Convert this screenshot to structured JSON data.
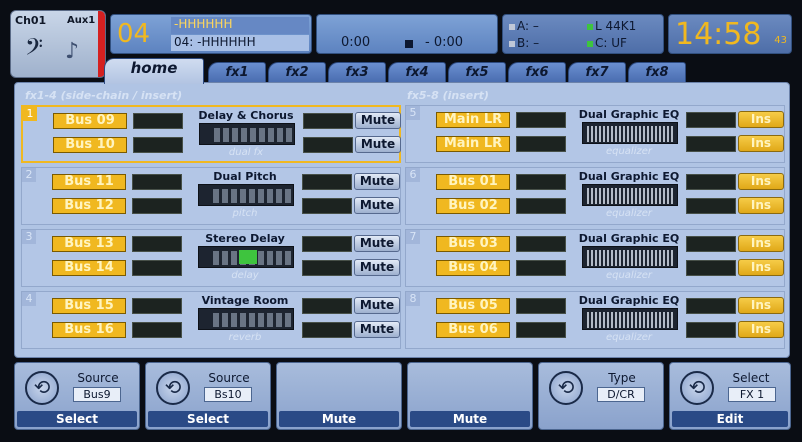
{
  "channel": {
    "name": "Ch01",
    "bus": "Aux1"
  },
  "scene": {
    "number": "04",
    "line1": "-HHHHHH",
    "line2": "04: -HHHHHH"
  },
  "transport": {
    "elapsed": "0:00",
    "remaining": "- 0:00"
  },
  "usb": {
    "a_label": "A:",
    "a_value": "–",
    "b_label": "B:",
    "b_value": "–",
    "l_label": "L",
    "l_value": "44K1",
    "c_label": "C:",
    "c_value": "UF"
  },
  "clock": {
    "time": "14:58",
    "seconds": "43"
  },
  "tabs": [
    "home",
    "fx1",
    "fx2",
    "fx3",
    "fx4",
    "fx5",
    "fx6",
    "fx7",
    "fx8"
  ],
  "sections": {
    "left": "fx1-4 (side-chain / insert)",
    "right": "fx5-8 (insert)"
  },
  "slots": [
    {
      "n": "1",
      "in1": "Bus 09",
      "in2": "Bus 10",
      "name": "Delay & Chorus",
      "type": "dual fx",
      "b1": "Mute",
      "b2": "Mute"
    },
    {
      "n": "2",
      "in1": "Bus 11",
      "in2": "Bus 12",
      "name": "Dual Pitch",
      "type": "pitch",
      "b1": "Mute",
      "b2": "Mute"
    },
    {
      "n": "3",
      "in1": "Bus 13",
      "in2": "Bus 14",
      "name": "Stereo Delay",
      "type": "delay",
      "b1": "Mute",
      "b2": "Mute"
    },
    {
      "n": "4",
      "in1": "Bus 15",
      "in2": "Bus 16",
      "name": "Vintage Room",
      "type": "reverb",
      "b1": "Mute",
      "b2": "Mute"
    },
    {
      "n": "5",
      "in1": "Main LR",
      "in2": "Main LR",
      "name": "Dual Graphic EQ",
      "type": "equalizer",
      "b1": "Ins",
      "b2": "Ins"
    },
    {
      "n": "6",
      "in1": "Bus 01",
      "in2": "Bus 02",
      "name": "Dual Graphic EQ",
      "type": "equalizer",
      "b1": "Ins",
      "b2": "Ins"
    },
    {
      "n": "7",
      "in1": "Bus 03",
      "in2": "Bus 04",
      "name": "Dual Graphic EQ",
      "type": "equalizer",
      "b1": "Ins",
      "b2": "Ins"
    },
    {
      "n": "8",
      "in1": "Bus 05",
      "in2": "Bus 06",
      "name": "Dual Graphic EQ",
      "type": "equalizer",
      "b1": "Ins",
      "b2": "Ins"
    }
  ],
  "softkeys": [
    {
      "label": "Source",
      "value": "Bus9",
      "action": "Select"
    },
    {
      "label": "Source",
      "value": "Bs10",
      "action": "Select"
    },
    {
      "label": "",
      "value": "",
      "action": "Mute"
    },
    {
      "label": "",
      "value": "",
      "action": "Mute"
    },
    {
      "label": "Type",
      "value": "D/CR",
      "action": ""
    },
    {
      "label": "Select",
      "value": "FX 1",
      "action": "Edit"
    }
  ],
  "colors": {
    "accent": "#f0b820",
    "panel": "#b0c4e4",
    "channel_strip": "#d42020"
  }
}
